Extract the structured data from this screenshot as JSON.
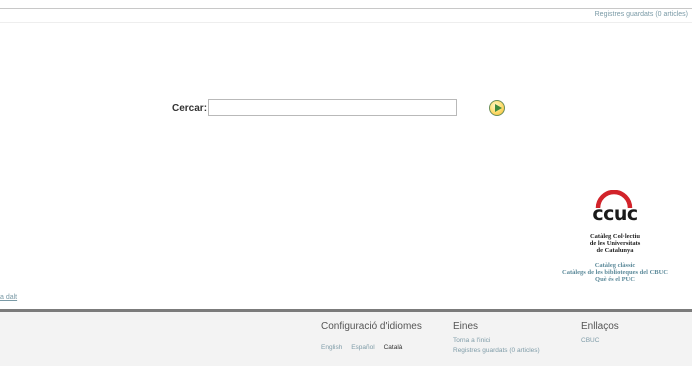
{
  "header": {
    "saved_records": "Registres guardats (0 articles)"
  },
  "search": {
    "label": "Cercar:",
    "value": "",
    "button_icon": "go-arrow-icon"
  },
  "ccuc": {
    "logo_text": "ccuc",
    "name_lines": [
      "Catàleg Col·lectiu",
      "de les Universitats",
      "de Catalunya"
    ],
    "links": [
      "Catàleg clàssic",
      "Catàlegs de les biblioteques del CBUC",
      "Què és el PUC"
    ]
  },
  "left_fragment": "a dalt",
  "footer": {
    "languages": {
      "title": "Configuració d'idiomes",
      "options": [
        "English",
        "Español",
        "Català"
      ],
      "active": "Català"
    },
    "tools": {
      "title": "Eines",
      "links": [
        "Torna a l'inici",
        "Registres guardats (0 articles)"
      ]
    },
    "links": {
      "title": "Enllaços",
      "items": [
        "CBUC"
      ]
    }
  },
  "colors": {
    "link": "#7a9aa6",
    "ccuc_red": "#d2232a",
    "footer_bar": "#7b7b7b",
    "footer_bg": "#f3f3f3"
  }
}
